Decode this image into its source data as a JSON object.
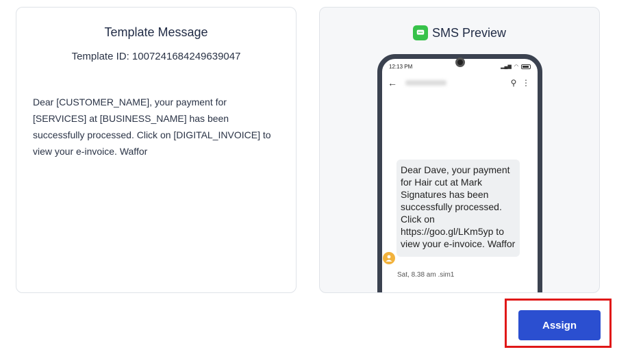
{
  "template_card": {
    "title": "Template Message",
    "template_id_text": "Template ID: 1007241684249639047",
    "body": "Dear [CUSTOMER_NAME], your payment for [SERVICES] at [BUSINESS_NAME] has been successfully processed. Click on [DIGITAL_INVOICE] to view your e-invoice. Waffor"
  },
  "preview_card": {
    "title": "SMS Preview",
    "phone": {
      "time": "12:13 PM",
      "message": "Dear Dave, your payment for Hair cut at Mark Signatures has been successfully processed. Click on https://goo.gl/LKm5yp to view your e-invoice. Waffor",
      "timestamp": "Sat, 8.38 am .sim1"
    }
  },
  "actions": {
    "assign_label": "Assign"
  },
  "colors": {
    "primary": "#2b4fd0",
    "highlight": "#e01818",
    "chat_icon": "#37c24a"
  }
}
